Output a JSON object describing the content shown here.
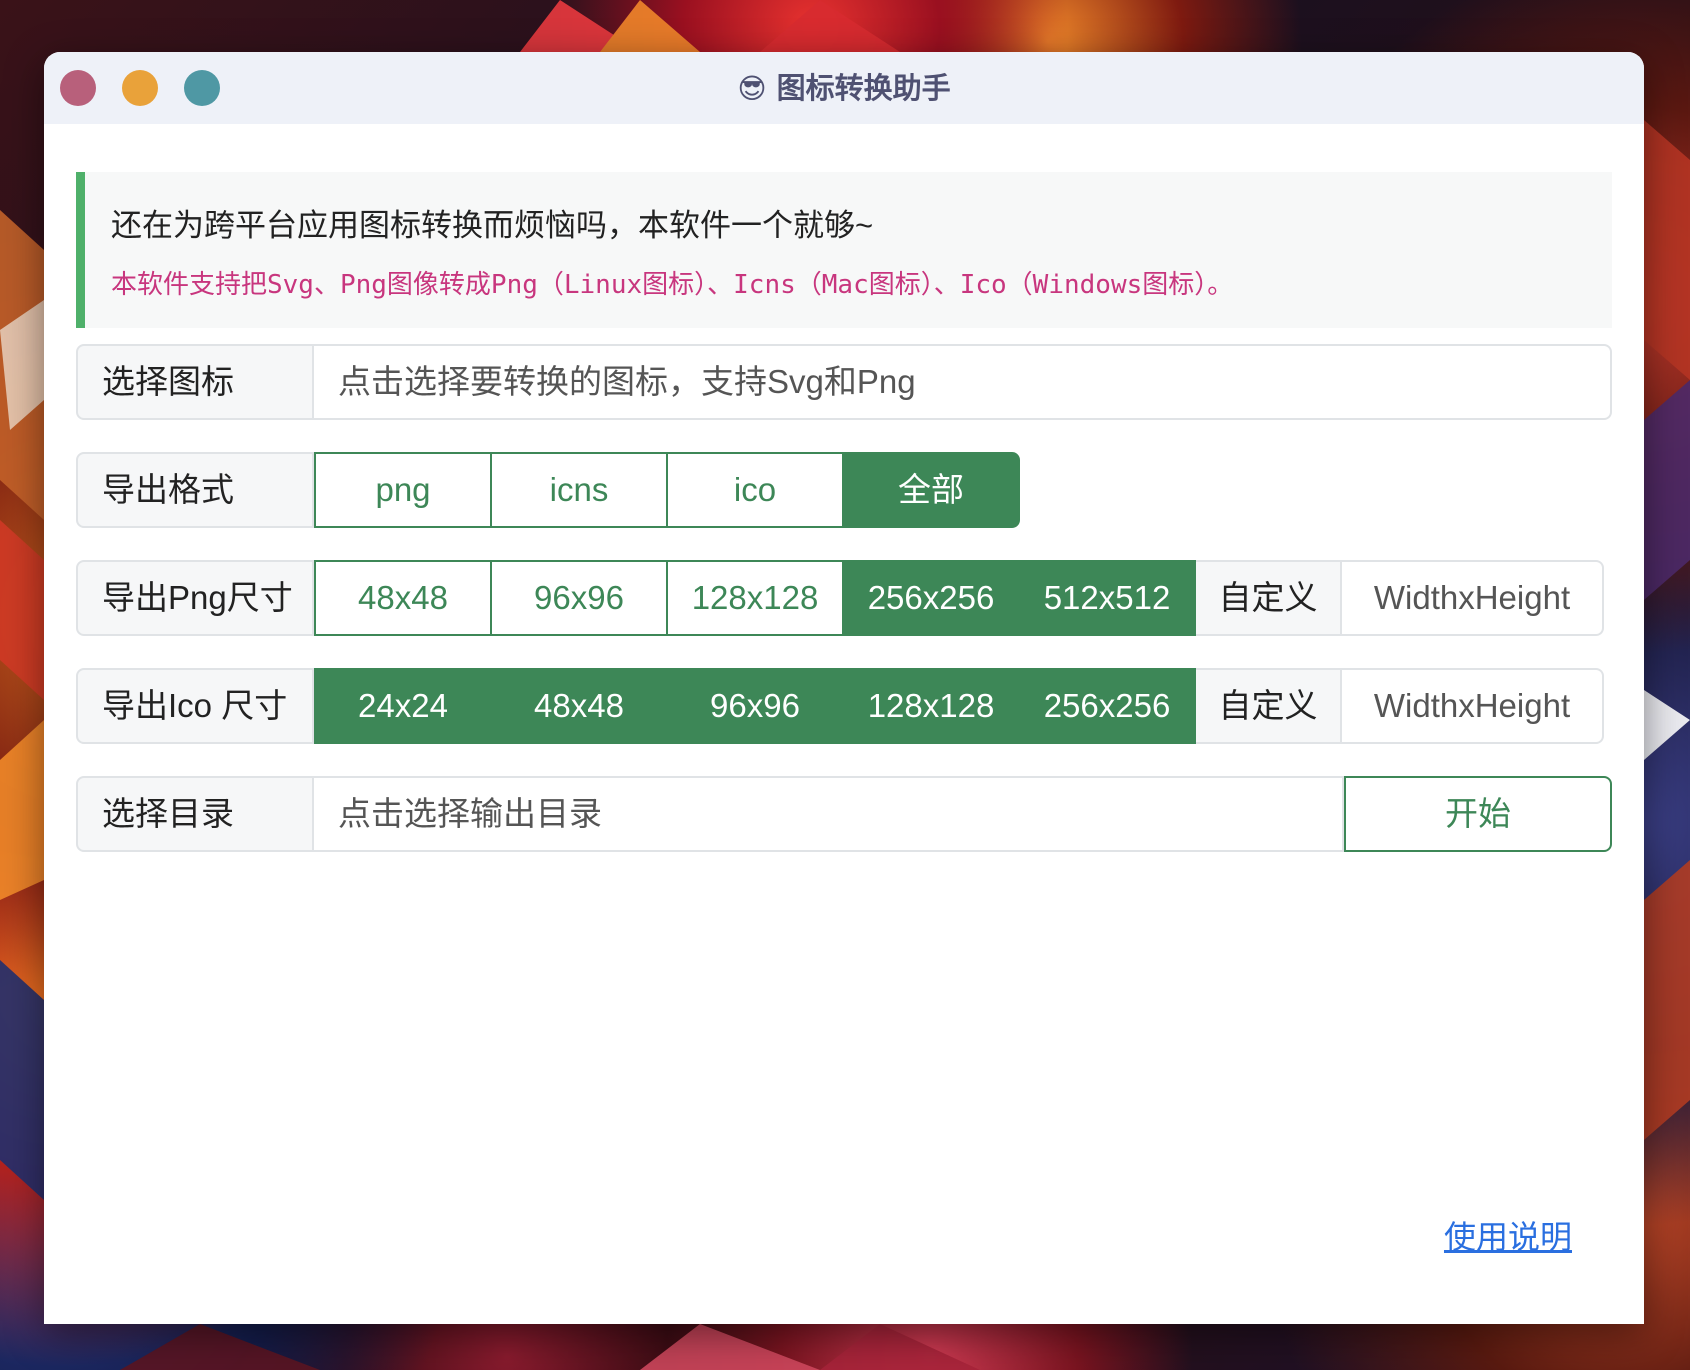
{
  "window": {
    "emoji": "😎",
    "title": "图标转换助手"
  },
  "notice": {
    "line1": "还在为跨平台应用图标转换而烦恼吗，本软件一个就够~",
    "line2": "本软件支持把Svg、Png图像转成Png（Linux图标）、Icns（Mac图标）、Ico（Windows图标）。"
  },
  "select_icon": {
    "label": "选择图标",
    "placeholder": "点击选择要转换的图标，支持Svg和Png"
  },
  "export_format": {
    "label": "导出格式",
    "options": [
      {
        "label": "png",
        "selected": false
      },
      {
        "label": "icns",
        "selected": false
      },
      {
        "label": "ico",
        "selected": false
      },
      {
        "label": "全部",
        "selected": true
      }
    ]
  },
  "png_size": {
    "label": "导出Png尺寸",
    "options": [
      {
        "label": "48x48",
        "selected": false
      },
      {
        "label": "96x96",
        "selected": false
      },
      {
        "label": "128x128",
        "selected": false
      },
      {
        "label": "256x256",
        "selected": true
      },
      {
        "label": "512x512",
        "selected": true
      }
    ],
    "custom_label": "自定义",
    "custom_placeholder": "WidthxHeight"
  },
  "ico_size": {
    "label": "导出Ico 尺寸",
    "options": [
      {
        "label": "24x24",
        "selected": true
      },
      {
        "label": "48x48",
        "selected": true
      },
      {
        "label": "96x96",
        "selected": true
      },
      {
        "label": "128x128",
        "selected": true
      },
      {
        "label": "256x256",
        "selected": true
      }
    ],
    "custom_label": "自定义",
    "custom_placeholder": "WidthxHeight"
  },
  "select_dir": {
    "label": "选择目录",
    "placeholder": "点击选择输出目录",
    "start_label": "开始"
  },
  "help": {
    "label": "使用说明"
  },
  "colors": {
    "accent_green": "#3d8757",
    "notice_border": "#4fb06a",
    "notice_pink": "#c8367e",
    "link_blue": "#2a6fe0"
  }
}
